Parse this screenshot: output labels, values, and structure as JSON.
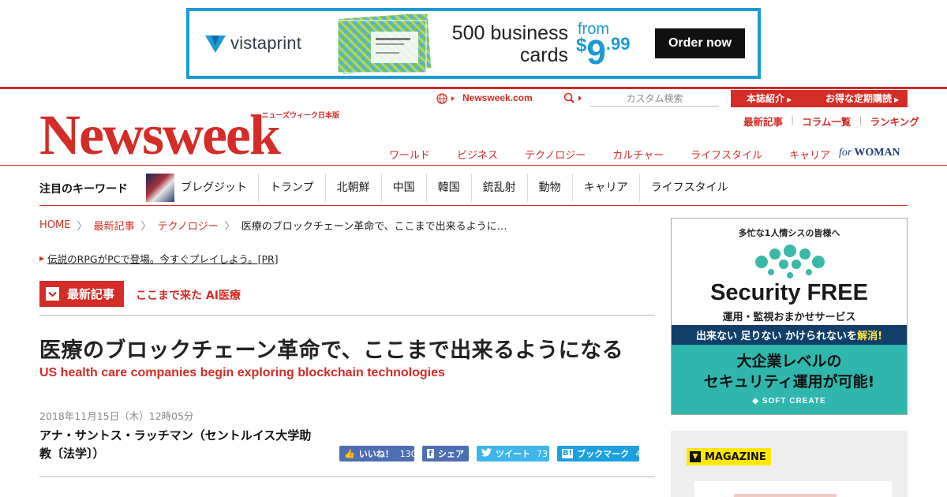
{
  "ad_top": {
    "brand": "vistaprint",
    "headline_line1": "500 business",
    "headline_line2": "cards",
    "price_from": "from",
    "price_dollar": "$",
    "price_int": "9",
    "price_cents": ".99",
    "cta": "Order now",
    "accent_color": "#1b9ad6"
  },
  "header": {
    "logo_tagline": "ニューズウィーク日本版",
    "logo_word": "Newsweek",
    "site_link": "Newsweek.com",
    "search_placeholder": "カスタム検索",
    "tab_about": "本誌紹介",
    "tab_subscribe": "お得な定期購読",
    "sub_links": [
      "最新記事",
      "コラム一覧",
      "ランキング"
    ],
    "nav": [
      "ワールド",
      "ビジネス",
      "テクノロジー",
      "カルチャー",
      "ライフスタイル",
      "キャリア"
    ],
    "for_woman_prefix": "for",
    "for_woman": "WOMAN",
    "brand_color": "#d42c26"
  },
  "keywords": {
    "label": "注目のキーワード",
    "items": [
      "ブレグジット",
      "トランプ",
      "北朝鮮",
      "中国",
      "韓国",
      "銃乱射",
      "動物",
      "キャリア",
      "ライフスタイル"
    ]
  },
  "breadcrumb": {
    "items": [
      "HOME",
      "最新記事",
      "テクノロジー"
    ],
    "current": "医療のブロックチェーン革命で、ここまで出来るように…"
  },
  "pr_link": "伝説のRPGがPCで登場。今すぐプレイしよう。[PR]",
  "article": {
    "category": "最新記事",
    "topic": "ここまで来た AI医療",
    "title": "医療のブロックチェーン革命で、ここまで出来るようになる",
    "subtitle": "US health care companies begin exploring blockchain technologies",
    "date": "2018年11月15日（木）12時05分",
    "author": "アナ・サントス・ラッチマン（セントルイス大学助教〔法学〕）"
  },
  "share": {
    "like_label": "いいね！",
    "like_count": "130",
    "fb_label": "シェア",
    "tweet_label": "ツイート",
    "tweet_count": "73",
    "hatena_label": "ブックマーク",
    "hatena_count": "4"
  },
  "side_ad": {
    "top_text": "多忙な1人情シスの皆様へ",
    "brand": "Security FREE",
    "service": "運用・監視おまかせサービス",
    "bar_text_a": "出来ない 足りない かけられないを ",
    "bar_text_b": "解消!",
    "big_line1": "大企業レベルの",
    "big_line2": "セキュリティ運用が可能!",
    "maker": "SOFT CREATE"
  },
  "magazine": {
    "label": "MAGAZINE"
  }
}
